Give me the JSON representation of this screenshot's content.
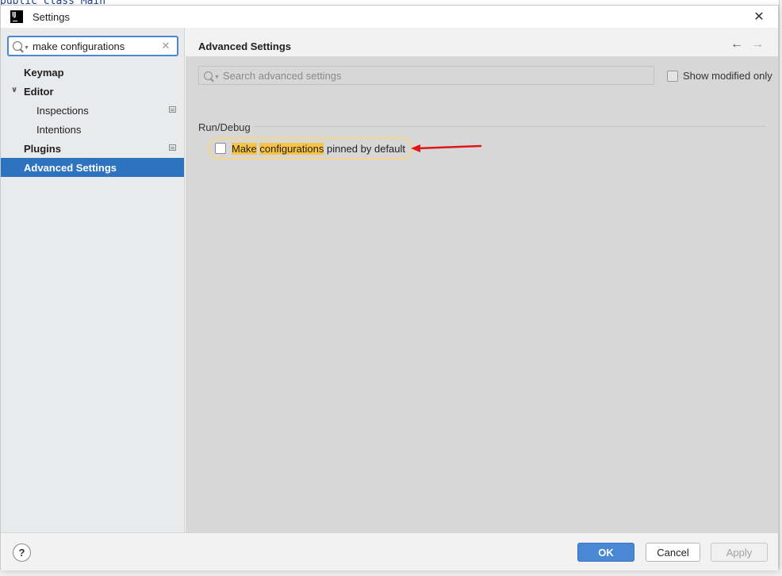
{
  "background": {
    "code_fragment": "public class Main"
  },
  "window": {
    "title": "Settings",
    "app_icon_text": "IJ",
    "close_glyph": "✕"
  },
  "sidebar": {
    "search": {
      "value": "make configurations",
      "clear_glyph": "✕"
    },
    "items": [
      {
        "label": "Keymap",
        "bold": true,
        "indent": 0
      },
      {
        "label": "Editor",
        "bold": true,
        "indent": 0,
        "expanded": true
      },
      {
        "label": "Inspections",
        "bold": false,
        "indent": 1
      },
      {
        "label": "Intentions",
        "bold": false,
        "indent": 1
      },
      {
        "label": "Plugins",
        "bold": true,
        "indent": 0
      },
      {
        "label": "Advanced Settings",
        "bold": true,
        "indent": 0,
        "selected": true
      }
    ]
  },
  "main": {
    "title": "Advanced Settings",
    "back_glyph": "←",
    "forward_glyph": "→",
    "search_placeholder": "Search advanced settings",
    "show_modified_label": "Show modified only",
    "show_modified_checked": false,
    "section": "Run/Debug",
    "setting": {
      "part1": "Make",
      "part2": " ",
      "part3": "configurations",
      "part4": " pinned by default",
      "checked": false
    },
    "annotation_color": "#e0161b"
  },
  "footer": {
    "help_glyph": "?",
    "ok_label": "OK",
    "cancel_label": "Cancel",
    "apply_label": "Apply"
  },
  "colors": {
    "accent": "#2e73c0",
    "ok_button": "#4a87d4",
    "highlight": "#f8c445"
  }
}
